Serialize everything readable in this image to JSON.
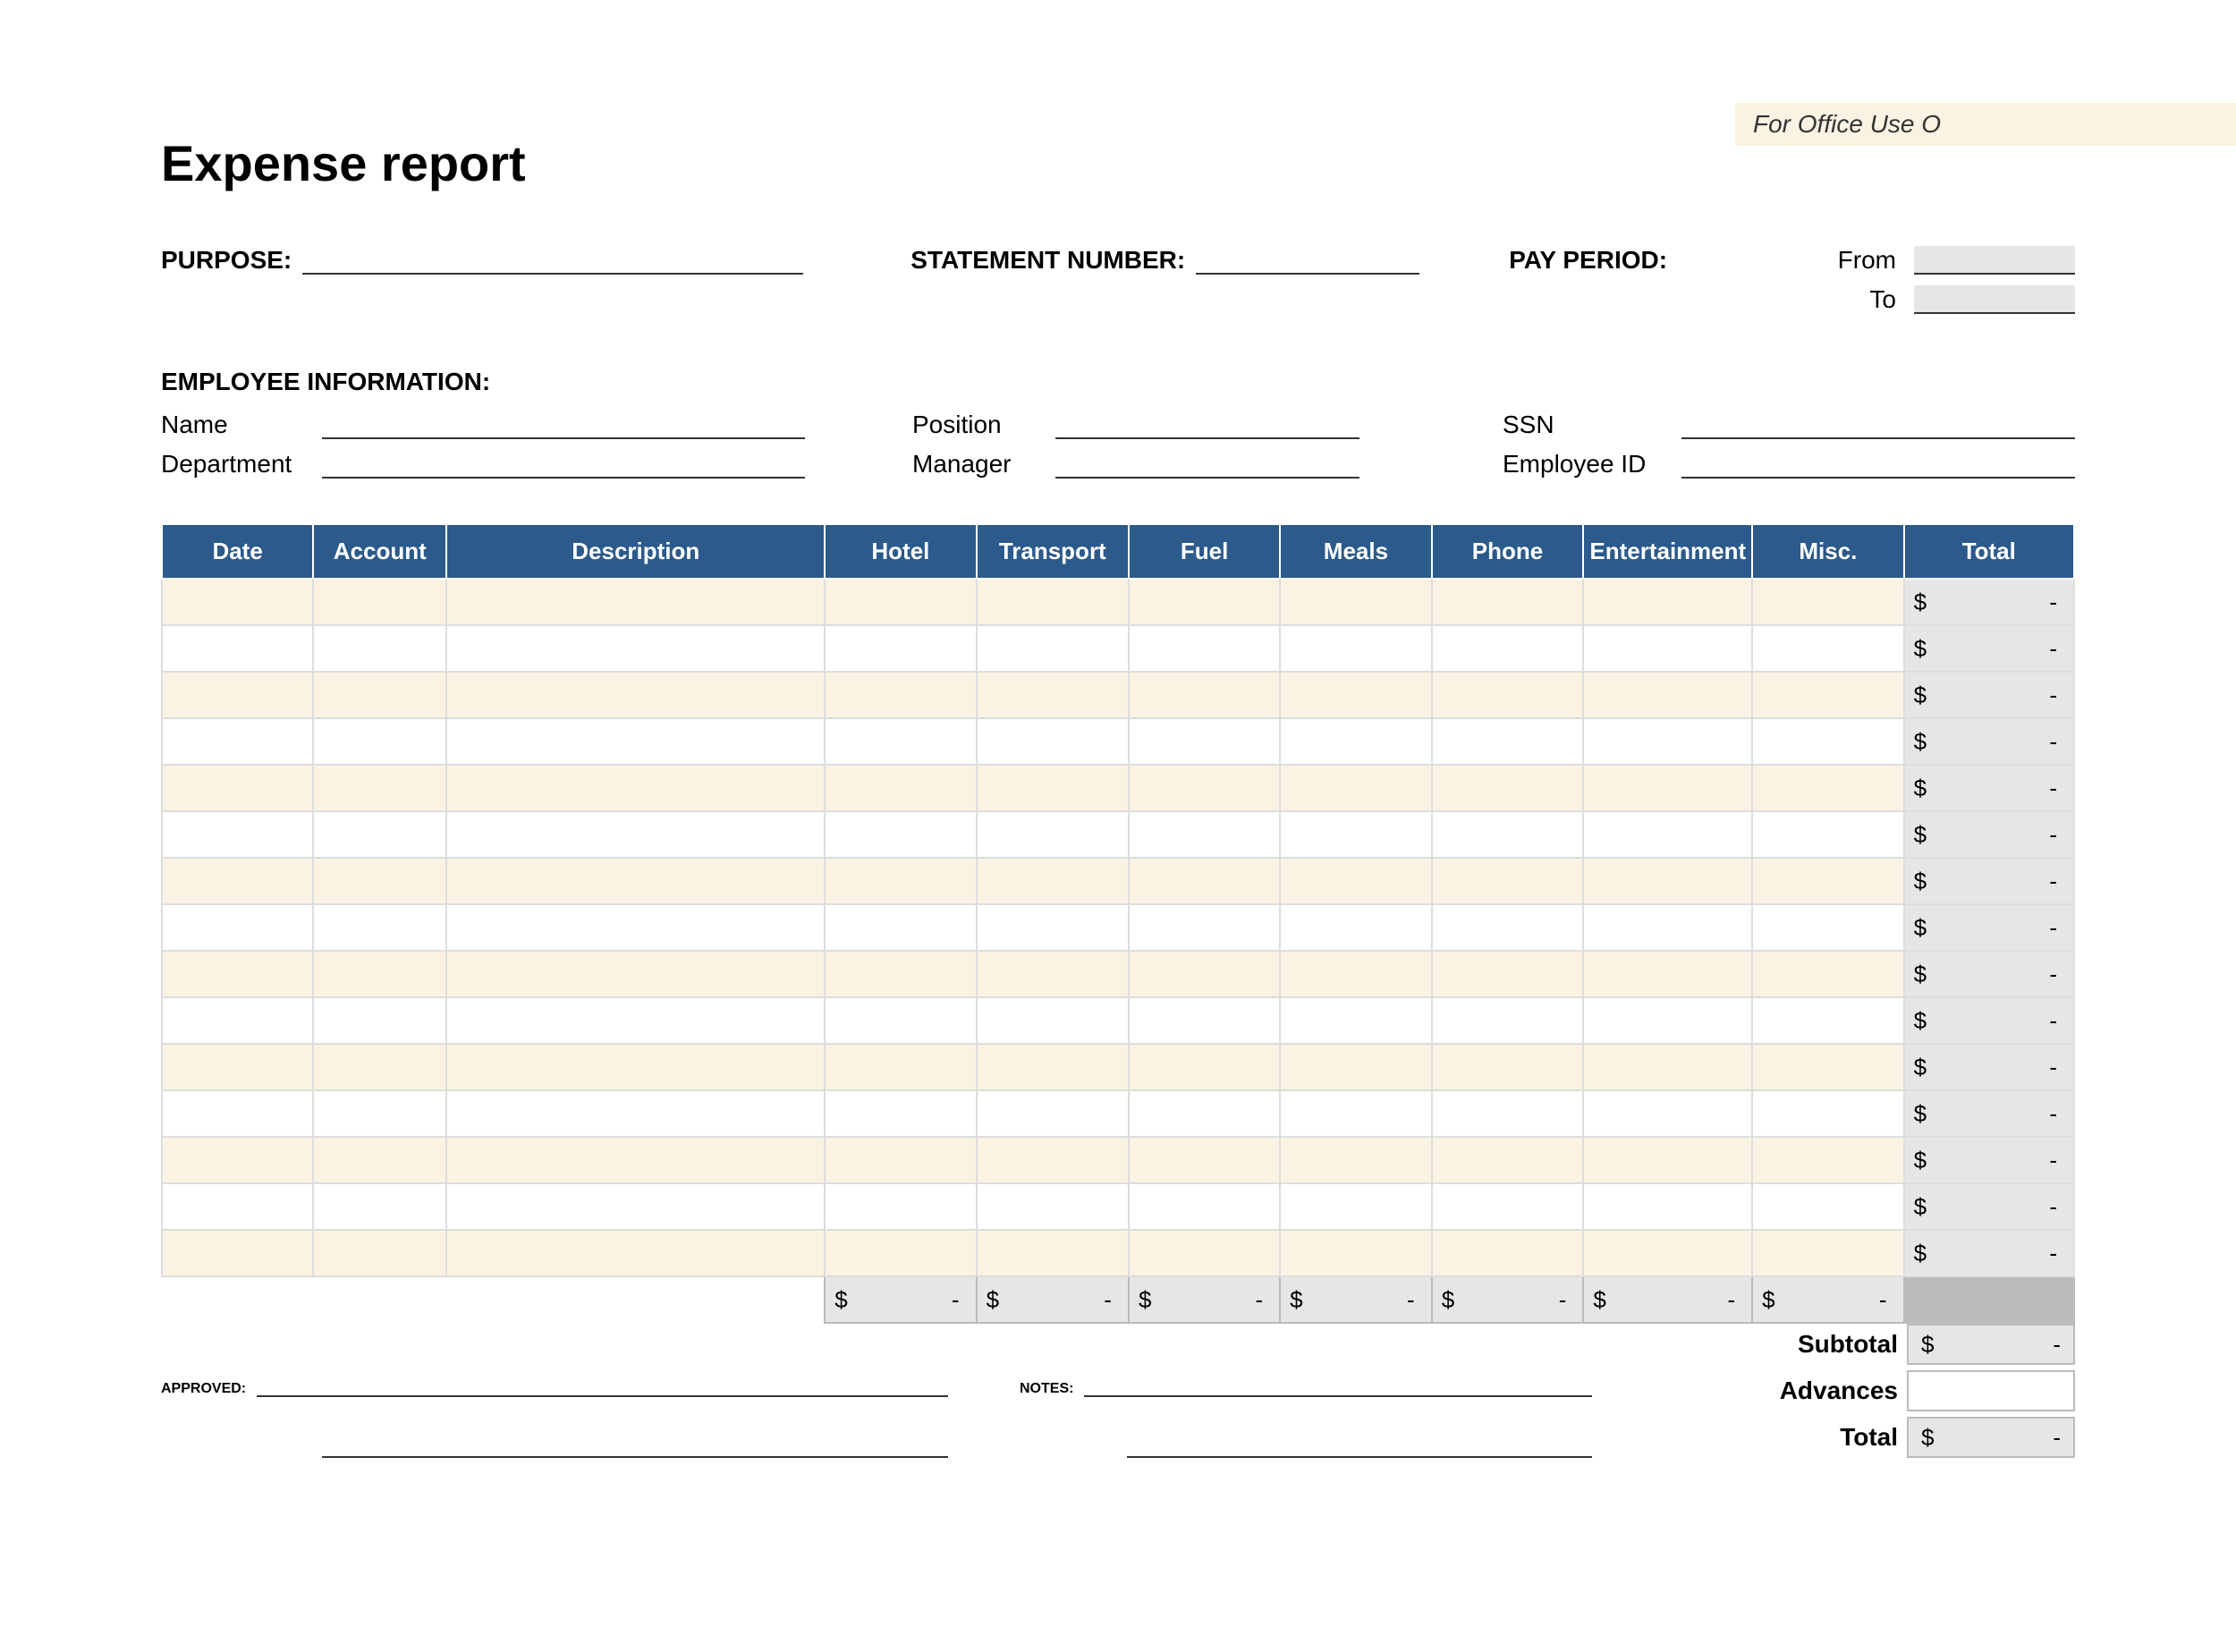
{
  "office_use_label": "For Office Use O",
  "title": "Expense report",
  "labels": {
    "purpose": "PURPOSE:",
    "statement_number": "STATEMENT NUMBER:",
    "pay_period": "PAY PERIOD:",
    "from": "From",
    "to": "To",
    "employee_info": "EMPLOYEE INFORMATION:",
    "name": "Name",
    "position": "Position",
    "ssn": "SSN",
    "department": "Department",
    "manager": "Manager",
    "employee_id": "Employee ID",
    "approved": "APPROVED:",
    "notes": "NOTES:",
    "subtotal": "Subtotal",
    "advances": "Advances",
    "total": "Total"
  },
  "fields": {
    "purpose": "",
    "statement_number": "",
    "pay_period_from": "",
    "pay_period_to": "",
    "name": "",
    "position": "",
    "ssn": "",
    "department": "",
    "manager": "",
    "employee_id": "",
    "approved_line1": "",
    "approved_line2": "",
    "notes_line1": "",
    "notes_line2": ""
  },
  "table": {
    "headers": [
      "Date",
      "Account",
      "Description",
      "Hotel",
      "Transport",
      "Fuel",
      "Meals",
      "Phone",
      "Entertainment",
      "Misc.",
      "Total"
    ],
    "rows": [
      {
        "date": "",
        "account": "",
        "description": "",
        "hotel": "",
        "transport": "",
        "fuel": "",
        "meals": "",
        "phone": "",
        "entertainment": "",
        "misc": "",
        "total_currency": "$",
        "total_value": "-"
      },
      {
        "date": "",
        "account": "",
        "description": "",
        "hotel": "",
        "transport": "",
        "fuel": "",
        "meals": "",
        "phone": "",
        "entertainment": "",
        "misc": "",
        "total_currency": "$",
        "total_value": "-"
      },
      {
        "date": "",
        "account": "",
        "description": "",
        "hotel": "",
        "transport": "",
        "fuel": "",
        "meals": "",
        "phone": "",
        "entertainment": "",
        "misc": "",
        "total_currency": "$",
        "total_value": "-"
      },
      {
        "date": "",
        "account": "",
        "description": "",
        "hotel": "",
        "transport": "",
        "fuel": "",
        "meals": "",
        "phone": "",
        "entertainment": "",
        "misc": "",
        "total_currency": "$",
        "total_value": "-"
      },
      {
        "date": "",
        "account": "",
        "description": "",
        "hotel": "",
        "transport": "",
        "fuel": "",
        "meals": "",
        "phone": "",
        "entertainment": "",
        "misc": "",
        "total_currency": "$",
        "total_value": "-"
      },
      {
        "date": "",
        "account": "",
        "description": "",
        "hotel": "",
        "transport": "",
        "fuel": "",
        "meals": "",
        "phone": "",
        "entertainment": "",
        "misc": "",
        "total_currency": "$",
        "total_value": "-"
      },
      {
        "date": "",
        "account": "",
        "description": "",
        "hotel": "",
        "transport": "",
        "fuel": "",
        "meals": "",
        "phone": "",
        "entertainment": "",
        "misc": "",
        "total_currency": "$",
        "total_value": "-"
      },
      {
        "date": "",
        "account": "",
        "description": "",
        "hotel": "",
        "transport": "",
        "fuel": "",
        "meals": "",
        "phone": "",
        "entertainment": "",
        "misc": "",
        "total_currency": "$",
        "total_value": "-"
      },
      {
        "date": "",
        "account": "",
        "description": "",
        "hotel": "",
        "transport": "",
        "fuel": "",
        "meals": "",
        "phone": "",
        "entertainment": "",
        "misc": "",
        "total_currency": "$",
        "total_value": "-"
      },
      {
        "date": "",
        "account": "",
        "description": "",
        "hotel": "",
        "transport": "",
        "fuel": "",
        "meals": "",
        "phone": "",
        "entertainment": "",
        "misc": "",
        "total_currency": "$",
        "total_value": "-"
      },
      {
        "date": "",
        "account": "",
        "description": "",
        "hotel": "",
        "transport": "",
        "fuel": "",
        "meals": "",
        "phone": "",
        "entertainment": "",
        "misc": "",
        "total_currency": "$",
        "total_value": "-"
      },
      {
        "date": "",
        "account": "",
        "description": "",
        "hotel": "",
        "transport": "",
        "fuel": "",
        "meals": "",
        "phone": "",
        "entertainment": "",
        "misc": "",
        "total_currency": "$",
        "total_value": "-"
      },
      {
        "date": "",
        "account": "",
        "description": "",
        "hotel": "",
        "transport": "",
        "fuel": "",
        "meals": "",
        "phone": "",
        "entertainment": "",
        "misc": "",
        "total_currency": "$",
        "total_value": "-"
      },
      {
        "date": "",
        "account": "",
        "description": "",
        "hotel": "",
        "transport": "",
        "fuel": "",
        "meals": "",
        "phone": "",
        "entertainment": "",
        "misc": "",
        "total_currency": "$",
        "total_value": "-"
      },
      {
        "date": "",
        "account": "",
        "description": "",
        "hotel": "",
        "transport": "",
        "fuel": "",
        "meals": "",
        "phone": "",
        "entertainment": "",
        "misc": "",
        "total_currency": "$",
        "total_value": "-"
      }
    ],
    "column_totals": {
      "hotel": {
        "currency": "$",
        "value": "-"
      },
      "transport": {
        "currency": "$",
        "value": "-"
      },
      "fuel": {
        "currency": "$",
        "value": "-"
      },
      "meals": {
        "currency": "$",
        "value": "-"
      },
      "phone": {
        "currency": "$",
        "value": "-"
      },
      "entertainment": {
        "currency": "$",
        "value": "-"
      },
      "misc": {
        "currency": "$",
        "value": "-"
      }
    }
  },
  "summary": {
    "subtotal": {
      "currency": "$",
      "value": "-"
    },
    "advances": {
      "currency": "",
      "value": ""
    },
    "total": {
      "currency": "$",
      "value": "-"
    }
  }
}
